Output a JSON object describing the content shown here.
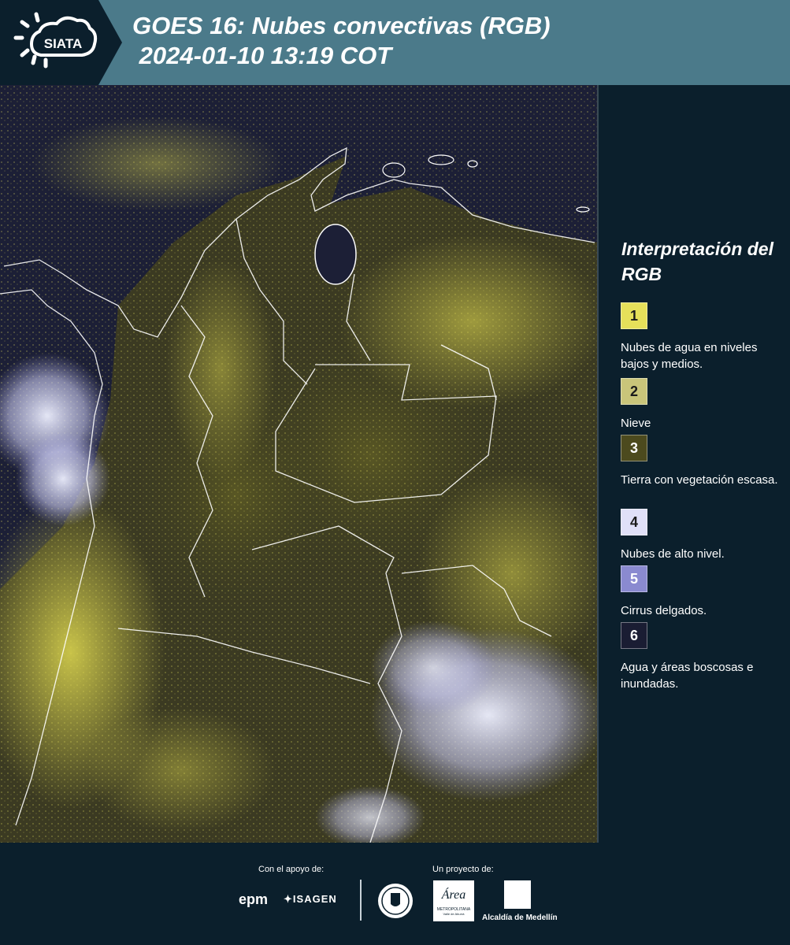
{
  "header": {
    "title_line1": "GOES 16: Nubes convectivas (RGB)",
    "title_line2": " 2024-01-10 13:19 COT",
    "logo_text": "SIATA"
  },
  "map": {
    "region": "Colombia",
    "product": "GOES 16 Nubes convectivas RGB composite"
  },
  "legend": {
    "title": "Interpretación del RGB",
    "items": [
      {
        "num": "1",
        "color": "#e6e05a",
        "label": "Nubes de agua en niveles bajos y medios."
      },
      {
        "num": "2",
        "color": "#c9c57a",
        "label": "Nieve"
      },
      {
        "num": "3",
        "color": "#4c4a1e",
        "label": "Tierra con vegetación escasa."
      },
      {
        "num": "4",
        "color": "#e0e0f8",
        "label": "Nubes de alto nivel."
      },
      {
        "num": "5",
        "color": "#8a8ad0",
        "label": "Cirrus delgados."
      },
      {
        "num": "6",
        "color": "#1a1d33",
        "label": "Agua y áreas boscosas e inundadas."
      }
    ]
  },
  "footer": {
    "support_label": "Con el apoyo de:",
    "project_label": "Un proyecto de:",
    "epm": "epm",
    "isagen": "ISAGEN",
    "area_metro": "Área",
    "area_metro_sub": "METROPOLITANA",
    "area_metro_sub2": "Valle de Aburrá",
    "alcaldia": "Alcaldía de Medellín"
  },
  "colors": {
    "header_bg": "#4b7a8a",
    "logo_bg": "#0b1f2c",
    "page_bg": "#0b1f2c",
    "map_water": "#1a1e35",
    "low_cloud_yellow": "#e6e05a",
    "high_cloud_white": "#e0e0f8"
  }
}
